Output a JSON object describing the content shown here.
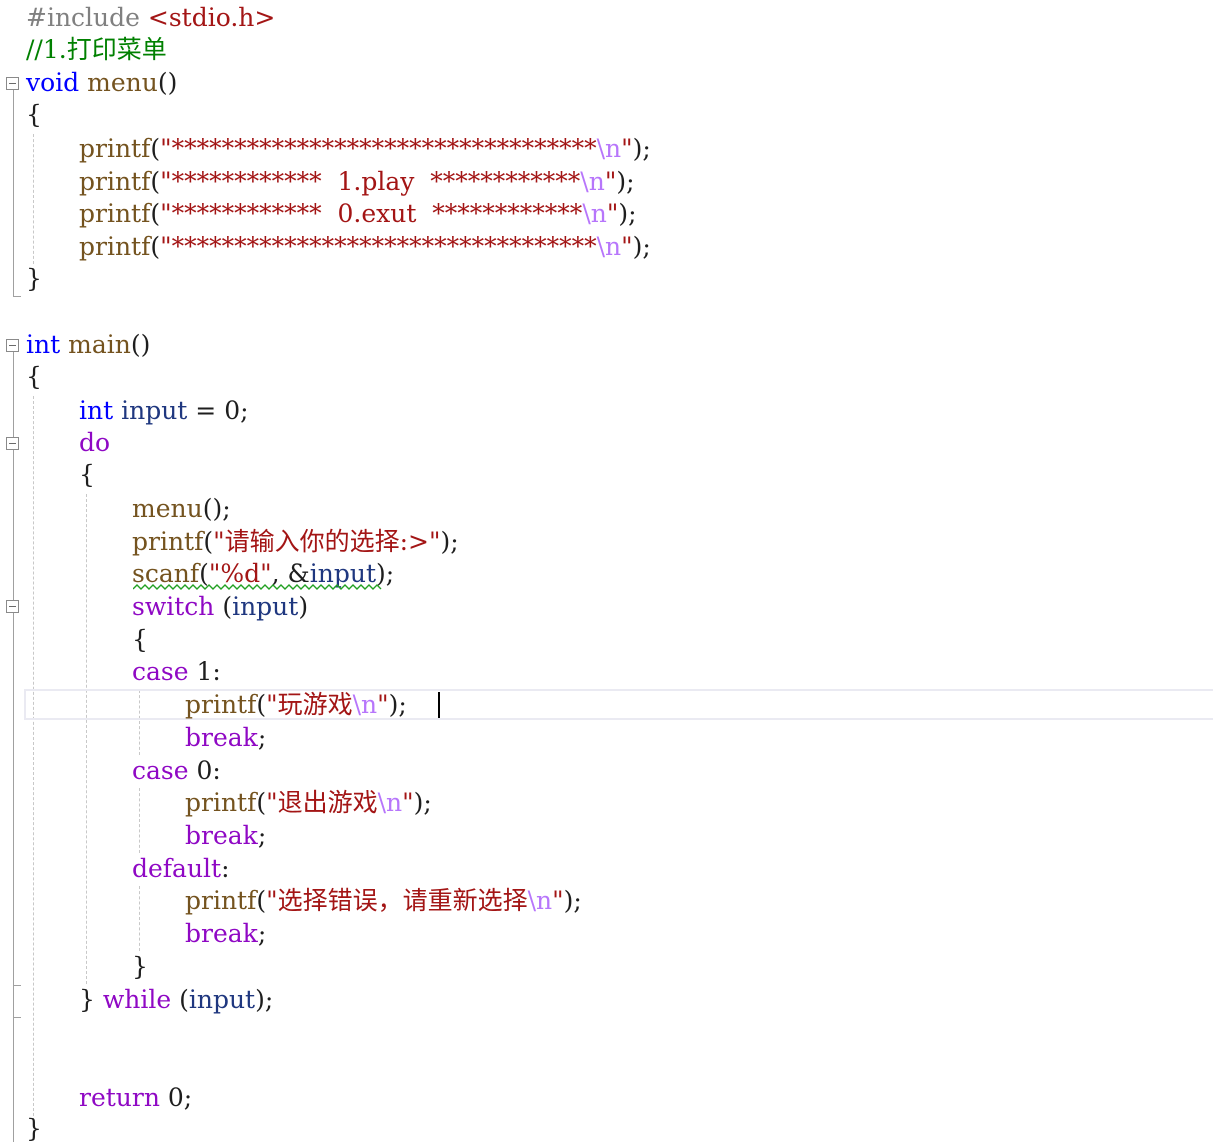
{
  "code": {
    "l1_directive": "#include",
    "l1_header": "<stdio.h>",
    "l2_comment": "//1.打印菜单",
    "l3_type": "void",
    "l3_name": "menu",
    "l3_parens": "()",
    "l4_brace": "{",
    "menu_lines": [
      {
        "fn": "printf",
        "open": "(",
        "str": "\"**********************************",
        "esc": "\\n",
        "close_str": "\"",
        "end": ");"
      },
      {
        "fn": "printf",
        "open": "(",
        "str": "\"************  1.play  ************",
        "esc": "\\n",
        "close_str": "\"",
        "end": ");"
      },
      {
        "fn": "printf",
        "open": "(",
        "str": "\"************  0.exut  ************",
        "esc": "\\n",
        "close_str": "\"",
        "end": ");"
      },
      {
        "fn": "printf",
        "open": "(",
        "str": "\"**********************************",
        "esc": "\\n",
        "close_str": "\"",
        "end": ");"
      }
    ],
    "l9_brace": "}",
    "main_type": "int",
    "main_name": "main",
    "main_parens": "()",
    "main_open": "{",
    "decl_type": "int",
    "decl_var": "input",
    "decl_rest": " = 0;",
    "do_kw": "do",
    "do_open": "{",
    "menu_call_fn": "menu",
    "menu_call_rest": "();",
    "prompt_fn": "printf",
    "prompt_open": "(",
    "prompt_str": "\"请输入你的选择:>\"",
    "prompt_end": ");",
    "scanf_fn": "scanf",
    "scanf_open": "(",
    "scanf_str": "\"%d\"",
    "scanf_mid": ", &",
    "scanf_var": "input",
    "scanf_end": ");",
    "switch_kw": "switch",
    "switch_open": " (",
    "switch_var": "input",
    "switch_close": ")",
    "switch_brace": "{",
    "case1_kw": "case",
    "case1_rest": " 1:",
    "case1_print_fn": "printf",
    "case1_print_open": "(",
    "case1_print_str": "\"玩游戏",
    "case1_print_esc": "\\n",
    "case1_print_q": "\"",
    "case1_print_end": ");",
    "break1": "break",
    "break1_end": ";",
    "case0_kw": "case",
    "case0_rest": " 0:",
    "case0_print_fn": "printf",
    "case0_print_open": "(",
    "case0_print_str": "\"退出游戏",
    "case0_print_esc": "\\n",
    "case0_print_q": "\"",
    "case0_print_end": ");",
    "break2": "break",
    "break2_end": ";",
    "default_kw": "default",
    "default_rest": ":",
    "def_print_fn": "printf",
    "def_print_open": "(",
    "def_print_str": "\"选择错误，请重新选择",
    "def_print_esc": "\\n",
    "def_print_q": "\"",
    "def_print_end": ");",
    "break3": "break",
    "break3_end": ";",
    "switch_close_brace": "}",
    "while_close": "} ",
    "while_kw": "while",
    "while_open": " (",
    "while_var": "input",
    "while_end": ");",
    "return_kw": "return",
    "return_rest": " 0;",
    "main_close": "}"
  },
  "colors": {
    "keyword": "#0000ff",
    "control_keyword": "#8f08c4",
    "function": "#74531f",
    "string": "#a31515",
    "escape": "#b776fb",
    "comment": "#008000",
    "preprocessor": "#808080",
    "variable": "#1f377f",
    "squiggle": "#22a022"
  }
}
